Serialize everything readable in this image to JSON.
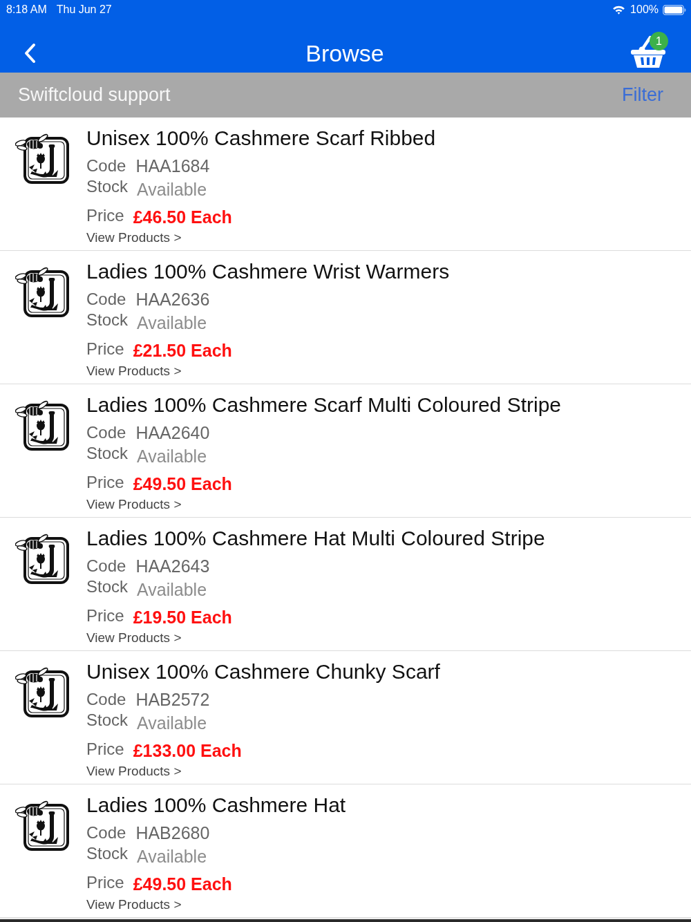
{
  "status_bar": {
    "time": "8:18 AM",
    "date": "Thu Jun 27",
    "battery": "100%"
  },
  "nav_bar": {
    "title": "Browse",
    "basket_count": "1"
  },
  "sub_header": {
    "account": "Swiftcloud support",
    "filter": "Filter"
  },
  "products": [
    {
      "name": "Unisex 100% Cashmere Scarf Ribbed",
      "code_label": "Code",
      "code": "HAA1684",
      "stock_label": "Stock",
      "stock": "Available",
      "price_label": "Price",
      "price": "£46.50 Each",
      "link": "View Products >"
    },
    {
      "name": "Ladies 100% Cashmere Wrist Warmers",
      "code_label": "Code",
      "code": "HAA2636",
      "stock_label": "Stock",
      "stock": "Available",
      "price_label": "Price",
      "price": "£21.50 Each",
      "link": "View Products >"
    },
    {
      "name": "Ladies 100% Cashmere Scarf Multi Coloured Stripe",
      "code_label": "Code",
      "code": "HAA2640",
      "stock_label": "Stock",
      "stock": "Available",
      "price_label": "Price",
      "price": "£49.50 Each",
      "link": "View Products >"
    },
    {
      "name": "Ladies 100% Cashmere Hat Multi Coloured Stripe",
      "code_label": "Code",
      "code": "HAA2643",
      "stock_label": "Stock",
      "stock": "Available",
      "price_label": "Price",
      "price": "£19.50 Each",
      "link": "View Products >"
    },
    {
      "name": "Unisex 100% Cashmere Chunky Scarf",
      "code_label": "Code",
      "code": "HAB2572",
      "stock_label": "Stock",
      "stock": "Available",
      "price_label": "Price",
      "price": "£133.00 Each",
      "link": "View Products >"
    },
    {
      "name": "Ladies 100% Cashmere Hat",
      "code_label": "Code",
      "code": "HAB2680",
      "stock_label": "Stock",
      "stock": "Available",
      "price_label": "Price",
      "price": "£49.50 Each",
      "link": "View Products >"
    }
  ]
}
